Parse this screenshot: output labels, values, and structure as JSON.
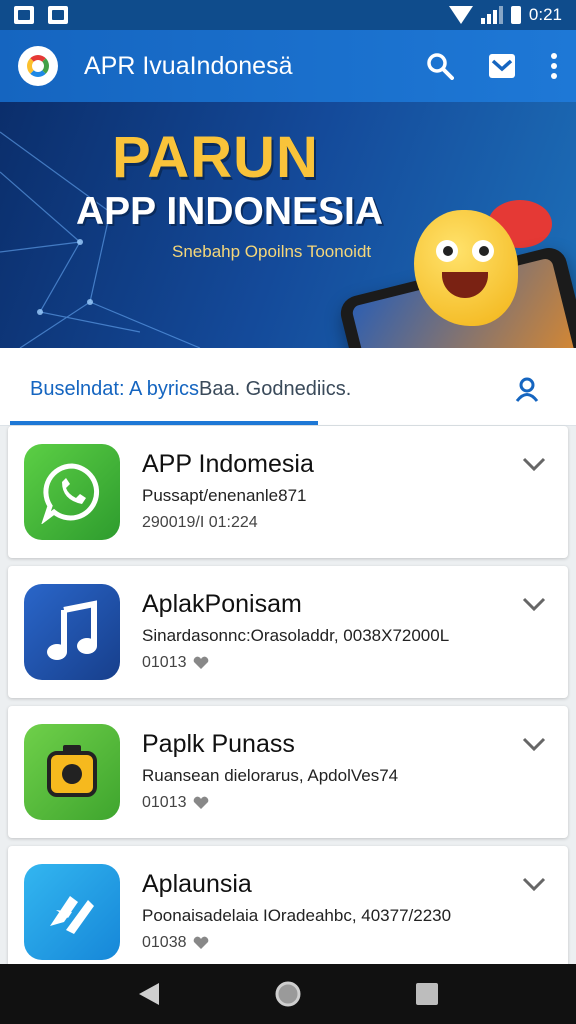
{
  "status_bar": {
    "time": "0:21"
  },
  "app_bar": {
    "title": "APR IvuaIndonesä"
  },
  "banner": {
    "headline": "PARUN",
    "subheadline": "APP INDONESIA",
    "caption": "Snebahp Opoilns Toonoidt"
  },
  "tabs": {
    "active_label": "Buselndat: A byrics",
    "inactive_label": "Baa. Godnediics."
  },
  "apps": [
    {
      "name": "APP Indomesia",
      "description": "Pussapt/enenanle871",
      "meta": "290019/I 01:224",
      "icon": "chat-icon",
      "color": "#43a047"
    },
    {
      "name": "AplakPonisam",
      "description": "Sinardasonnc:Orasoladdr, 0038X72000L",
      "meta": "01013",
      "icon": "music-note-icon",
      "color": "#1e4fa8"
    },
    {
      "name": "Paplk Punass",
      "description": "Ruansean dielorarus, ApdolVes74",
      "meta": "01013",
      "icon": "camera-icon",
      "color": "#5bbd3a"
    },
    {
      "name": "Aplaunsia",
      "description": "Poonaisadelaia IOradeahbc, 40377/2230",
      "meta": "01038",
      "icon": "plane-icon",
      "color": "#1e9fe0"
    }
  ]
}
